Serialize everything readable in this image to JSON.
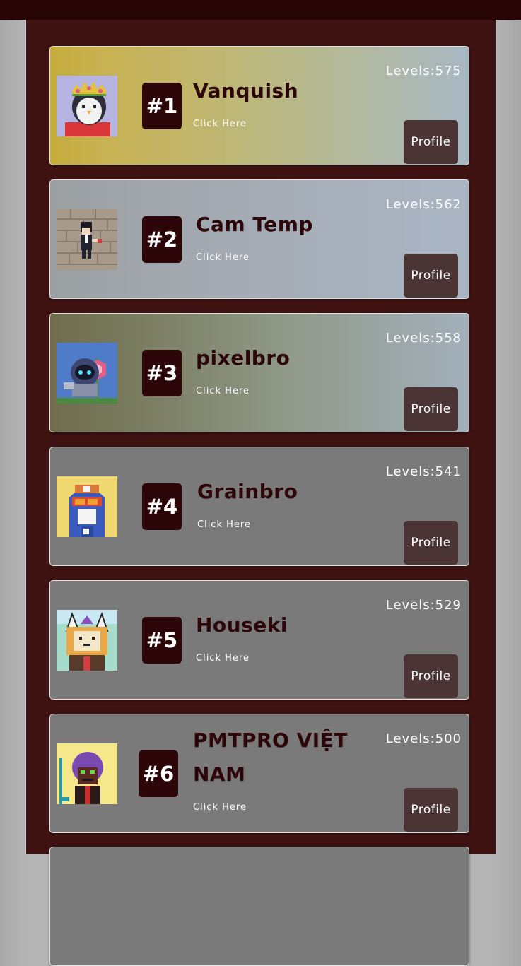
{
  "leaderboard": {
    "entries": [
      {
        "rank": "#1",
        "name": "Vanquish",
        "levels": "Levels:575",
        "link": "Click Here",
        "button": "Profile"
      },
      {
        "rank": "#2",
        "name": "Cam Temp",
        "levels": "Levels:562",
        "link": "Click Here",
        "button": "Profile"
      },
      {
        "rank": "#3",
        "name": "pixelbro",
        "levels": "Levels:558",
        "link": "Click Here",
        "button": "Profile"
      },
      {
        "rank": "#4",
        "name": "Grainbro",
        "levels": "Levels:541",
        "link": "Click Here",
        "button": "Profile"
      },
      {
        "rank": "#5",
        "name": "Houseki",
        "levels": "Levels:529",
        "link": "Click Here",
        "button": "Profile"
      },
      {
        "rank": "#6",
        "name": "PMTPRO VIỆT NAM",
        "levels": "Levels:500",
        "link": "Click Here",
        "button": "Profile"
      }
    ]
  },
  "colors": {
    "board": "#3e1211",
    "topbar": "#280505",
    "rank_badge": "#2c0608",
    "profile_button": "#4a3434"
  }
}
